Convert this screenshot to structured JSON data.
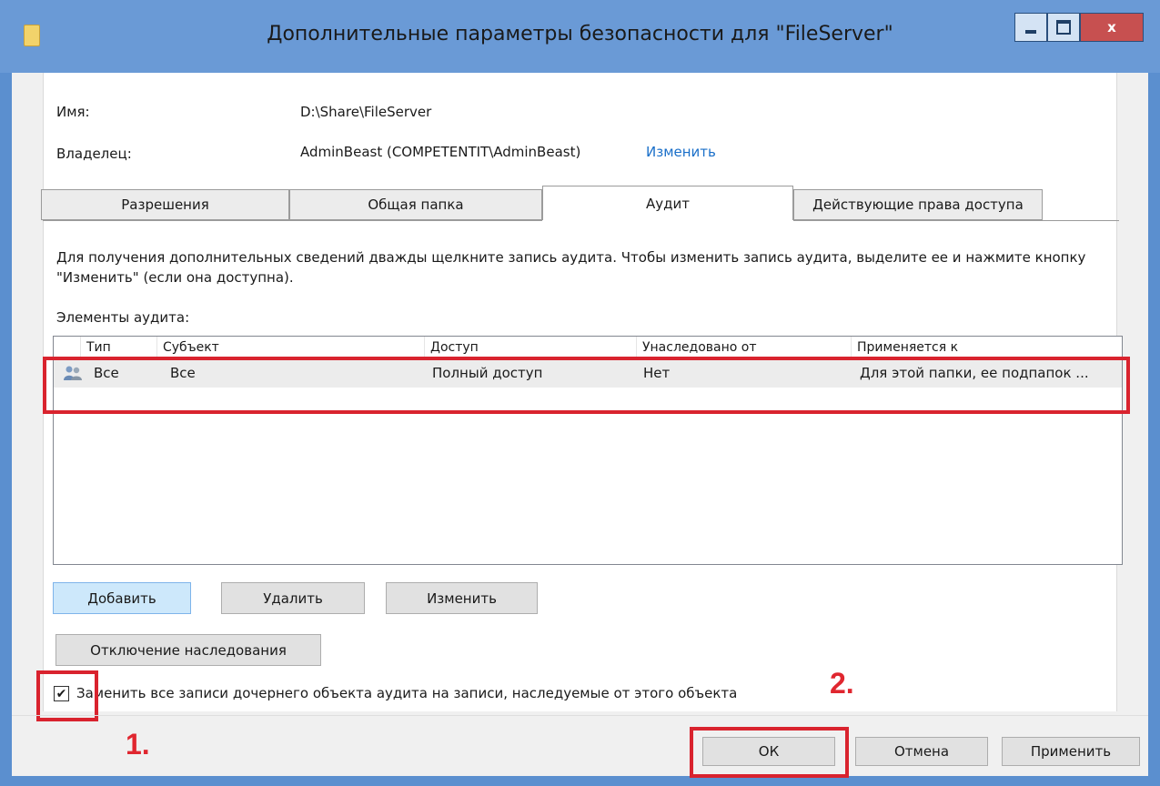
{
  "window": {
    "title": "Дополнительные параметры безопасности  для \"FileServer\"",
    "controls": {
      "minimize": "—",
      "maximize": "□",
      "close": "x"
    }
  },
  "info": {
    "name_label": "Имя:",
    "name_value": "D:\\Share\\FileServer",
    "owner_label": "Владелец:",
    "owner_value": "AdminBeast (COMPETENTIT\\AdminBeast)",
    "owner_change_link": "Изменить"
  },
  "tabs": [
    {
      "label": "Разрешения",
      "active": false
    },
    {
      "label": "Общая папка",
      "active": false
    },
    {
      "label": "Аудит",
      "active": true
    },
    {
      "label": "Действующие права доступа",
      "active": false
    }
  ],
  "audit": {
    "description": "Для получения дополнительных сведений дважды щелкните запись аудита. Чтобы изменить запись аудита, выделите ее и нажмите кнопку \"Изменить\" (если она доступна).",
    "entries_label": "Элементы аудита:",
    "columns": [
      "Тип",
      "Субъект",
      "Доступ",
      "Унаследовано от",
      "Применяется к"
    ],
    "rows": [
      {
        "type": "Все",
        "subject": "Все",
        "access": "Полный доступ",
        "inherited_from": "Нет",
        "applies_to": "Для этой папки, ее подпапок ..."
      }
    ],
    "buttons": {
      "add": "Добавить",
      "remove": "Удалить",
      "edit": "Изменить"
    },
    "disable_inheritance": "Отключение наследования",
    "replace_child_checkbox": {
      "label": "Заменить все записи дочернего объекта аудита на записи, наследуемые от этого объекта",
      "checked": true,
      "mark": "✔"
    }
  },
  "annotations": {
    "step1": "1.",
    "step2": "2."
  },
  "footer": {
    "ok": "ОК",
    "cancel": "Отмена",
    "apply": "Применить"
  },
  "colors": {
    "accent_red": "#d9232e",
    "link_blue": "#1a6fc9",
    "titlebar": "#6a9ad6"
  }
}
